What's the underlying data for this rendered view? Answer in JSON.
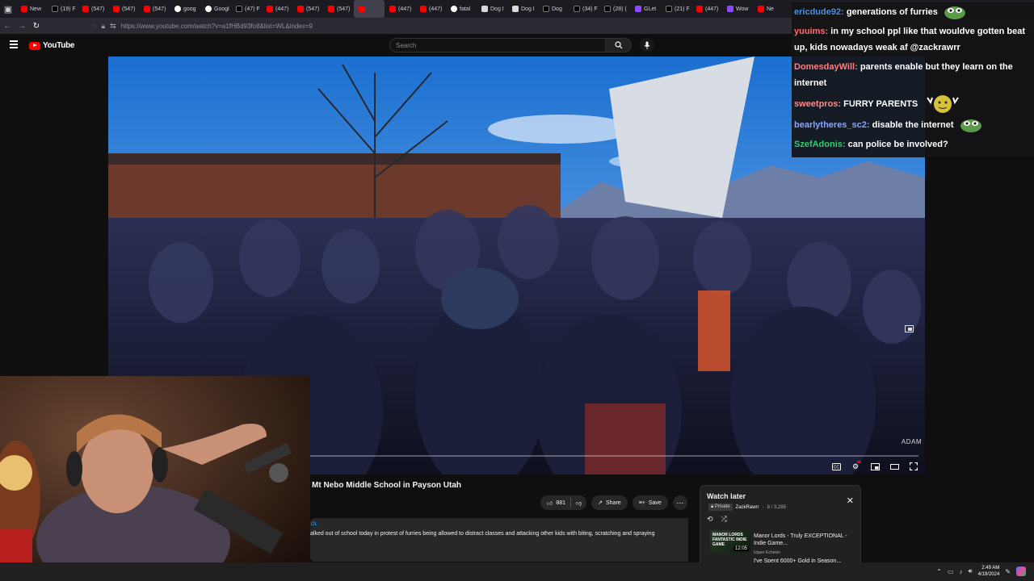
{
  "browser": {
    "tabs": [
      {
        "label": "New",
        "icon": "youtube-icon"
      },
      {
        "label": "(19) F",
        "icon": "x-icon"
      },
      {
        "label": "(547)",
        "icon": "youtube-icon"
      },
      {
        "label": "(547)",
        "icon": "youtube-icon"
      },
      {
        "label": "(547)",
        "icon": "youtube-icon"
      },
      {
        "label": "goog",
        "icon": "google-icon"
      },
      {
        "label": "Googl",
        "icon": "google-icon"
      },
      {
        "label": "(47) F",
        "icon": "x-icon"
      },
      {
        "label": "(447)",
        "icon": "youtube-icon"
      },
      {
        "label": "(547)",
        "icon": "youtube-icon"
      },
      {
        "label": "(547)",
        "icon": "youtube-icon"
      },
      {
        "label": "",
        "icon": "youtube-icon",
        "active": true
      },
      {
        "label": "(447)",
        "icon": "youtube-icon"
      },
      {
        "label": "(447)",
        "icon": "youtube-icon"
      },
      {
        "label": "fatal",
        "icon": "google-icon"
      },
      {
        "label": "Dog I",
        "icon": "doc-icon"
      },
      {
        "label": "Dog I",
        "icon": "doc-icon"
      },
      {
        "label": "Dog",
        "icon": "x-icon"
      },
      {
        "label": "(34) F",
        "icon": "x-icon"
      },
      {
        "label": "(28) (",
        "icon": "x-icon"
      },
      {
        "label": "GLet",
        "icon": "twitch-icon"
      },
      {
        "label": "(21) F",
        "icon": "x-icon"
      },
      {
        "label": "(447)",
        "icon": "youtube-icon"
      },
      {
        "label": "Wow",
        "icon": "twitch-icon"
      },
      {
        "label": "Ne",
        "icon": "youtube-icon"
      }
    ],
    "url": "https://www.youtube.com/watch?v=a1fHBd93fo8&list=WL&index=9"
  },
  "youtube": {
    "logo_text": "YouTube",
    "search_placeholder": "Search",
    "video_title": "Mt Nebo Middle School in Payson Utah",
    "watermark": "ADAM",
    "likes": "881",
    "share_label": "Share",
    "save_label": "Save",
    "description_tag": "OL",
    "description": "alked out of school today in protest of furries being allowed to distract classes and attacking other kids with biting, scratching and spraying"
  },
  "watch_later": {
    "title": "Watch later",
    "privacy": "Private",
    "owner": "ZackRawrr",
    "position": "8 / 3,285",
    "items": [
      {
        "title": "Manor Lords - Truly EXCEPTIONAL - Indie Game...",
        "channel": "Upper Echelon",
        "duration": "12:05",
        "thumb_text": "MANOR LORDS FANTASTIC INDIE GAME"
      }
    ],
    "next_title": "I've Spent 6000+ Gold in Season..."
  },
  "chat": {
    "messages": [
      {
        "user": "ericdude92:",
        "text": "generations of furries",
        "color": "#4a90e2",
        "emote": "pepe"
      },
      {
        "user": "yuuims:",
        "text": "in my school ppl like that wouldve gotten beat up, kids nowadays weak af @zackrawrr",
        "color": "#ff6b6b",
        "emote": ""
      },
      {
        "user": "DomesdayWill:",
        "text": "parents enable but they learn on the internet",
        "color": "#ff7f7f",
        "emote": ""
      },
      {
        "user": "sweetpros:",
        "text": "FURRY PARENTS",
        "color": "#ff8a8a",
        "emote": "clap"
      },
      {
        "user": "bearlytheres_sc2:",
        "text": "disable the internet",
        "color": "#8aa4ff",
        "emote": "pepe"
      },
      {
        "user": "SzefAdonis:",
        "text": "can police be involved?",
        "color": "#2ecc71",
        "emote": ""
      }
    ]
  },
  "taskbar": {
    "time": "2:49 AM",
    "date": "4/19/2024"
  }
}
